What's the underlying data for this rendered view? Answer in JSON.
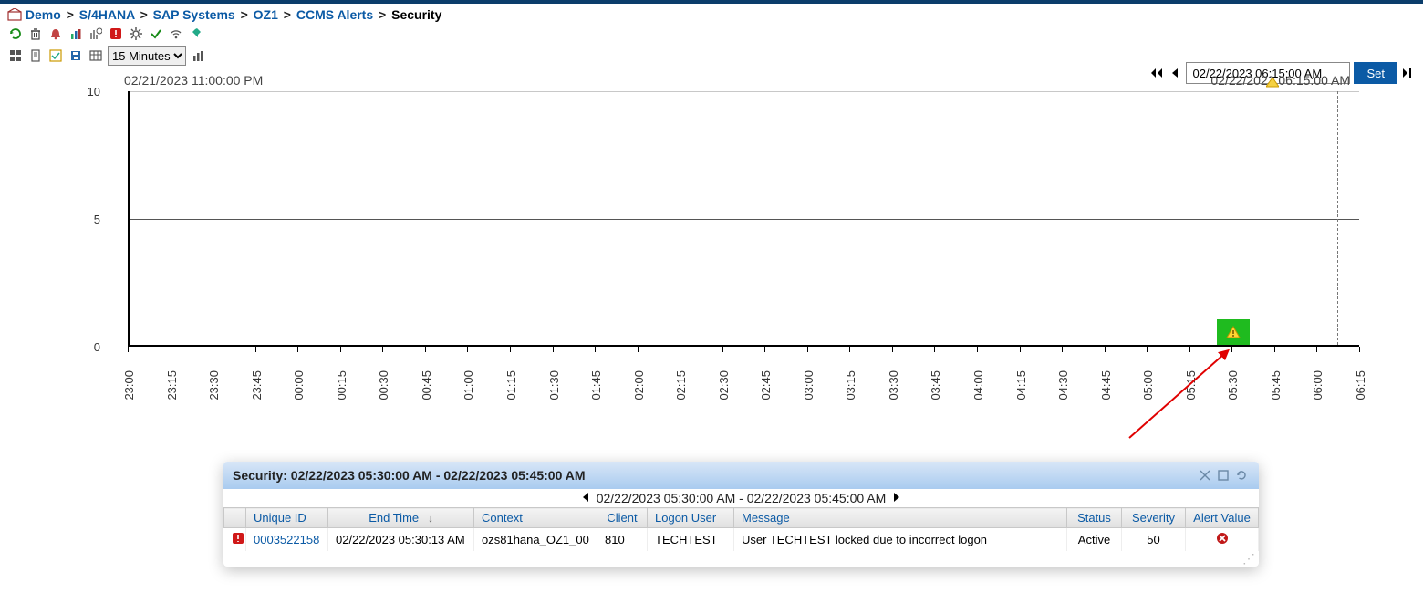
{
  "breadcrumb": {
    "items": [
      {
        "label": "Demo"
      },
      {
        "label": "S/4HANA"
      },
      {
        "label": "SAP Systems"
      },
      {
        "label": "OZ1"
      },
      {
        "label": "CCMS Alerts"
      }
    ],
    "current": "Security"
  },
  "toolbar1": {
    "icons": [
      "refresh",
      "trash",
      "bell",
      "bar-chart",
      "chart-settings",
      "tile-alert",
      "gear",
      "check",
      "wifi",
      "pin"
    ]
  },
  "toolbar2": {
    "icons": [
      "grid",
      "page",
      "check-list",
      "save",
      "table"
    ],
    "interval_options": [
      "15 Minutes"
    ],
    "interval_value": "15 Minutes",
    "chart_icon": "bar-chart"
  },
  "date_nav": {
    "value": "02/22/2023 06:15:00 AM",
    "set_label": "Set"
  },
  "chart": {
    "range_start_label": "02/21/2023 11:00:00 PM",
    "range_end_label": "02/22/2023 06:15:00 AM"
  },
  "chart_data": {
    "type": "bar",
    "ylim": [
      0,
      10
    ],
    "yticks": [
      0,
      5,
      10
    ],
    "categories": [
      "23:00",
      "23:15",
      "23:30",
      "23:45",
      "00:00",
      "00:15",
      "00:30",
      "00:45",
      "01:00",
      "01:15",
      "01:30",
      "01:45",
      "02:00",
      "02:15",
      "02:30",
      "02:45",
      "03:00",
      "03:15",
      "03:30",
      "03:45",
      "04:00",
      "04:15",
      "04:30",
      "04:45",
      "05:00",
      "05:15",
      "05:30",
      "05:45",
      "06:00",
      "06:15"
    ],
    "values": [
      0,
      0,
      0,
      0,
      0,
      0,
      0,
      0,
      0,
      0,
      0,
      0,
      0,
      0,
      0,
      0,
      0,
      0,
      0,
      0,
      0,
      0,
      0,
      0,
      0,
      0,
      1,
      0,
      0,
      0
    ],
    "status": [
      "",
      "",
      "",
      "",
      "",
      "",
      "",
      "",
      "",
      "",
      "",
      "",
      "",
      "",
      "",
      "",
      "",
      "",
      "",
      "",
      "",
      "",
      "",
      "",
      "",
      "",
      "warning",
      "",
      "",
      ""
    ]
  },
  "panel": {
    "title": "Security: 02/22/2023 05:30:00 AM - 02/22/2023 05:45:00 AM",
    "subrange": "02/22/2023 05:30:00 AM - 02/22/2023 05:45:00 AM",
    "columns": {
      "icon": "",
      "unique_id": "Unique ID",
      "end_time": "End Time",
      "context": "Context",
      "client": "Client",
      "logon_user": "Logon User",
      "message": "Message",
      "status": "Status",
      "severity": "Severity",
      "alert_value": "Alert Value"
    },
    "rows": [
      {
        "unique_id": "0003522158",
        "end_time": "02/22/2023 05:30:13 AM",
        "context": "ozs81hana_OZ1_00",
        "client": "810",
        "logon_user": "TECHTEST",
        "message": "User TECHTEST locked due to incorrect logon",
        "status": "Active",
        "severity": "50",
        "alert_value_icon": "error"
      }
    ]
  }
}
